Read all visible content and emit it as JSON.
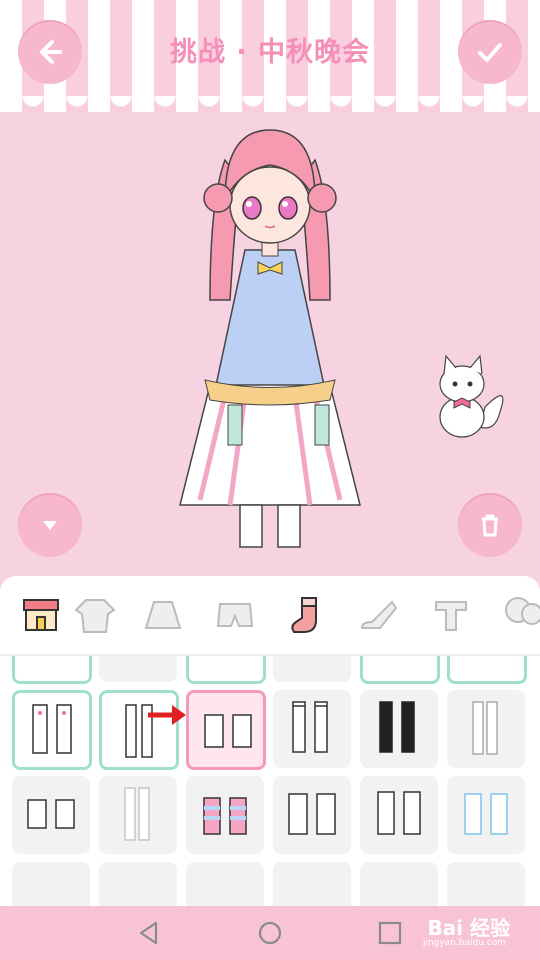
{
  "header": {
    "title": "挑战 · 中秋晚会",
    "back_icon": "back-arrow-icon",
    "confirm_icon": "check-icon"
  },
  "stage": {
    "scroll_down_icon": "chevron-down-icon",
    "trash_icon": "trash-icon"
  },
  "categories": [
    {
      "name": "shop",
      "icon": "shop-icon"
    },
    {
      "name": "coat",
      "icon": "jacket-icon"
    },
    {
      "name": "skirt",
      "icon": "skirt-icon"
    },
    {
      "name": "shorts",
      "icon": "shorts-icon"
    },
    {
      "name": "socks",
      "icon": "sock-icon",
      "active": true
    },
    {
      "name": "shoes",
      "icon": "heel-icon"
    },
    {
      "name": "accessory",
      "icon": "t-icon"
    },
    {
      "name": "balloon",
      "icon": "balloon-icon"
    }
  ],
  "colors": {
    "pink_accent": "#f58fb6",
    "mint_select": "#9fe0c9",
    "active_border": "#f59ab9",
    "annotation_arrow": "#e02020"
  },
  "watermark": {
    "brand": "Bai 经验",
    "url": "jingyan.baidu.com"
  }
}
